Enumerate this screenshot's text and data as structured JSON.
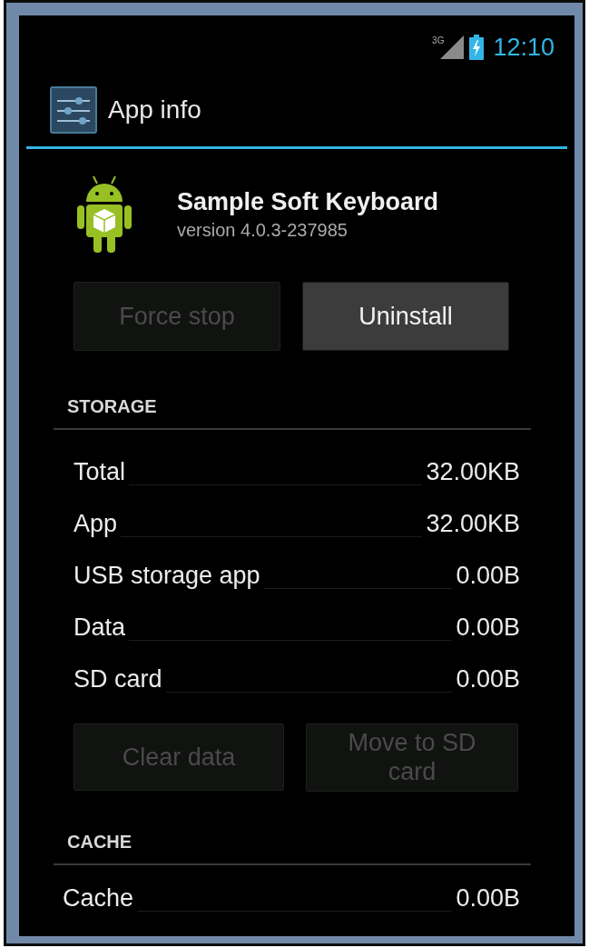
{
  "status_bar": {
    "network": "3G",
    "time": "12:10"
  },
  "action_bar": {
    "title": "App info"
  },
  "app": {
    "name": "Sample Soft Keyboard",
    "version": "version 4.0.3-237985"
  },
  "app_buttons": [
    {
      "label": "Force stop",
      "disabled": true
    },
    {
      "label": "Uninstall",
      "disabled": false
    }
  ],
  "sections": [
    {
      "header": "STORAGE",
      "rows": [
        {
          "label": "Total",
          "value": "32.00KB"
        },
        {
          "label": "App",
          "value": "32.00KB"
        },
        {
          "label": "USB storage app",
          "value": "0.00B"
        },
        {
          "label": "Data",
          "value": "0.00B"
        },
        {
          "label": "SD card",
          "value": "0.00B"
        }
      ],
      "buttons": [
        {
          "label": "Clear data",
          "disabled": true
        },
        {
          "label": "Move to SD card",
          "disabled": true
        }
      ]
    },
    {
      "header": "CACHE",
      "rows": [
        {
          "label": "Cache",
          "value": "0.00B"
        }
      ]
    }
  ]
}
